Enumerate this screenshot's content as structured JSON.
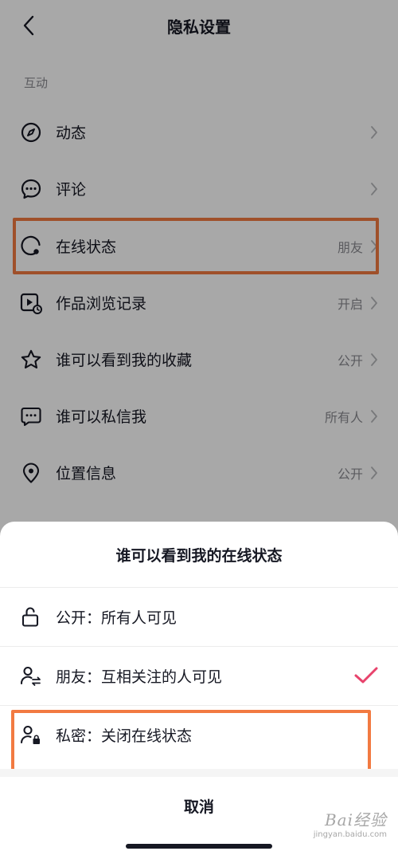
{
  "header": {
    "title": "隐私设置"
  },
  "section": {
    "label": "互动"
  },
  "settings": [
    {
      "label": "动态",
      "value": ""
    },
    {
      "label": "评论",
      "value": ""
    },
    {
      "label": "在线状态",
      "value": "朋友"
    },
    {
      "label": "作品浏览记录",
      "value": "开启"
    },
    {
      "label": "谁可以看到我的收藏",
      "value": "公开"
    },
    {
      "label": "谁可以私信我",
      "value": "所有人"
    },
    {
      "label": "位置信息",
      "value": "公开"
    }
  ],
  "sheet": {
    "title": "谁可以看到我的在线状态",
    "options": [
      {
        "label": "公开：所有人可见",
        "selected": false
      },
      {
        "label": "朋友：互相关注的人可见",
        "selected": true
      },
      {
        "label": "私密：关闭在线状态",
        "selected": false
      }
    ],
    "cancel": "取消"
  },
  "watermark": {
    "main": "Bai经验",
    "sub": "jingyan.baidu.com"
  },
  "colors": {
    "highlight": "#f27a41",
    "check": "#e8436c",
    "text": "#161823",
    "muted": "#8a8b91"
  }
}
